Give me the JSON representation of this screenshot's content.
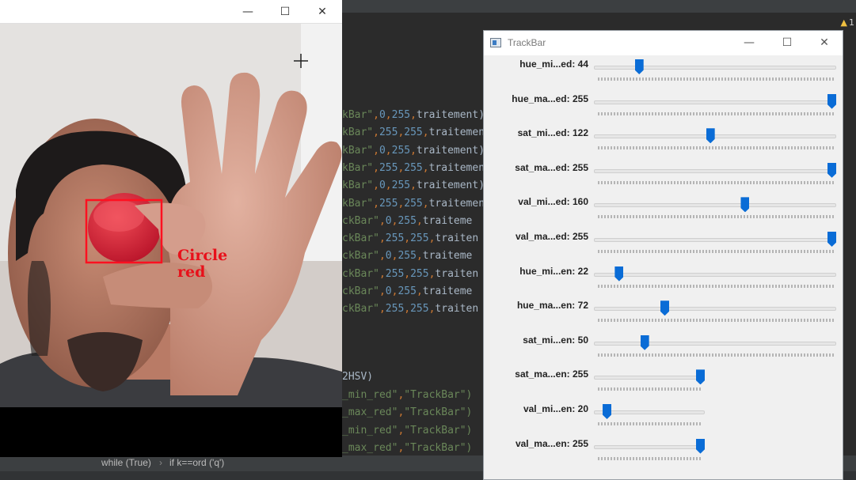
{
  "ide": {
    "warning_count": "1",
    "code_lines": [
      {
        "ind": "",
        "pre": "kBar\"",
        "a": "0",
        "b": "255",
        "tail": "traitement)"
      },
      {
        "ind": "",
        "pre": "kBar\"",
        "a": "255",
        "b": "255",
        "tail": "traitemen"
      },
      {
        "ind": "",
        "pre": "kBar\"",
        "a": "0",
        "b": "255",
        "tail": "traitement)"
      },
      {
        "ind": "",
        "pre": "kBar\"",
        "a": "255",
        "b": "255",
        "tail": "traitemen"
      },
      {
        "ind": "",
        "pre": "kBar\"",
        "a": "0",
        "b": "255",
        "tail": "traitement)"
      },
      {
        "ind": "",
        "pre": "kBar\"",
        "a": "255",
        "b": "255",
        "tail": "traitemen"
      },
      {
        "ind": "",
        "pre": "ckBar\"",
        "a": "0",
        "b": "255",
        "tail": "traiteme"
      },
      {
        "ind": "",
        "pre": "ckBar\"",
        "a": "255",
        "b": "255",
        "tail": "traiten"
      },
      {
        "ind": "",
        "pre": "ckBar\"",
        "a": "0",
        "b": "255",
        "tail": "traiteme"
      },
      {
        "ind": "",
        "pre": "ckBar\"",
        "a": "255",
        "b": "255",
        "tail": "traiten"
      },
      {
        "ind": "",
        "pre": "ckBar\"",
        "a": "0",
        "b": "255",
        "tail": "traiteme"
      },
      {
        "ind": "",
        "pre": "ckBar\"",
        "a": "255",
        "b": "255",
        "tail": "traiten"
      }
    ],
    "hsv_line": "2HSV)",
    "get_lines": [
      {
        "a": "_min_red\"",
        "b": "\"TrackBar\")"
      },
      {
        "a": "_max_red\"",
        "b": "\"TrackBar\")"
      },
      {
        "a": "_min_red\"",
        "b": "\"TrackBar\")"
      },
      {
        "a": "_max_red\"",
        "b": "\"TrackBar\")"
      }
    ],
    "breadcrumb": [
      "while (True)",
      "if k==ord ('q')"
    ]
  },
  "camera_window": {
    "minimize": "—",
    "maximize": "☐",
    "close": "✕",
    "detection_label_line1": "Circle",
    "detection_label_line2": "red",
    "accent_color": "#e8101a"
  },
  "trackbar_window": {
    "title": "TrackBar",
    "minimize": "—",
    "maximize": "☐",
    "close": "✕",
    "thumb_color": "#0a6cd6",
    "sliders": [
      {
        "label": "hue_mi...ed: 44",
        "value": 44,
        "max": 255
      },
      {
        "label": "hue_ma...ed: 255",
        "value": 255,
        "max": 255
      },
      {
        "label": "sat_mi...ed: 122",
        "value": 122,
        "max": 255
      },
      {
        "label": "sat_ma...ed: 255",
        "value": 255,
        "max": 255
      },
      {
        "label": "val_mi...ed: 160",
        "value": 160,
        "max": 255
      },
      {
        "label": "val_ma...ed: 255",
        "value": 255,
        "max": 255
      },
      {
        "label": "hue_mi...en: 22",
        "value": 22,
        "max": 255
      },
      {
        "label": "hue_ma...en: 72",
        "value": 72,
        "max": 255
      },
      {
        "label": "sat_mi...en: 50",
        "value": 50,
        "max": 255
      },
      {
        "label": "sat_ma...en: 255",
        "value": 255,
        "max": 255
      },
      {
        "label": "val_mi...en: 20",
        "value": 20,
        "max": 255
      },
      {
        "label": "val_ma...en: 255",
        "value": 255,
        "max": 255
      }
    ]
  }
}
